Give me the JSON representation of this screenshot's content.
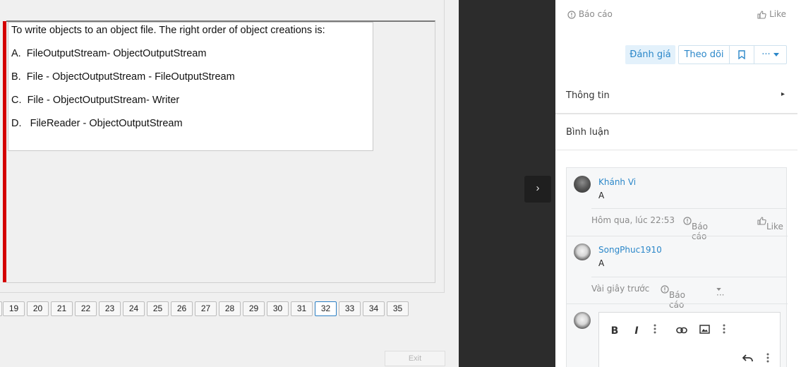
{
  "exam": {
    "question": "To write objects to an object file. The right order of object creations is:",
    "options": [
      {
        "letter": "A.",
        "text": "FileOutputStream- ObjectOutputStream"
      },
      {
        "letter": "B.",
        "text": "File - ObjectOutputStream - FileOutputStream"
      },
      {
        "letter": "C.",
        "text": "File - ObjectOutputStream- Writer"
      },
      {
        "letter": "D.",
        "text": "FileReader - ObjectOutputStream"
      }
    ],
    "pages": [
      "19",
      "20",
      "21",
      "22",
      "23",
      "24",
      "25",
      "26",
      "27",
      "28",
      "29",
      "30",
      "31",
      "32",
      "33",
      "34",
      "35"
    ],
    "current_page": "32",
    "exit_label": "Exit"
  },
  "gutter": {
    "expand_icon": "›"
  },
  "panel": {
    "top_report": "Báo cáo",
    "top_like": "Like",
    "actions": {
      "rate": "Đánh giá",
      "follow": "Theo dõi",
      "more": "···"
    },
    "info_label": "Thông tin",
    "comments_label": "Bình luận",
    "comments": [
      {
        "author": "Khánh Vi",
        "text": "A",
        "time": "Hôm qua, lúc 22:53",
        "report": "Báo cáo",
        "like": "Like"
      },
      {
        "author": "SongPhuc1910",
        "text": "A",
        "time": "Vài giây trước",
        "report": "Báo cáo",
        "more": "···"
      }
    ],
    "editor": {
      "bold": "B",
      "italic": "I"
    }
  },
  "colors": {
    "accent": "#2b87c9",
    "exam_marker": "#d40000",
    "gutter": "#2c2c2c"
  }
}
